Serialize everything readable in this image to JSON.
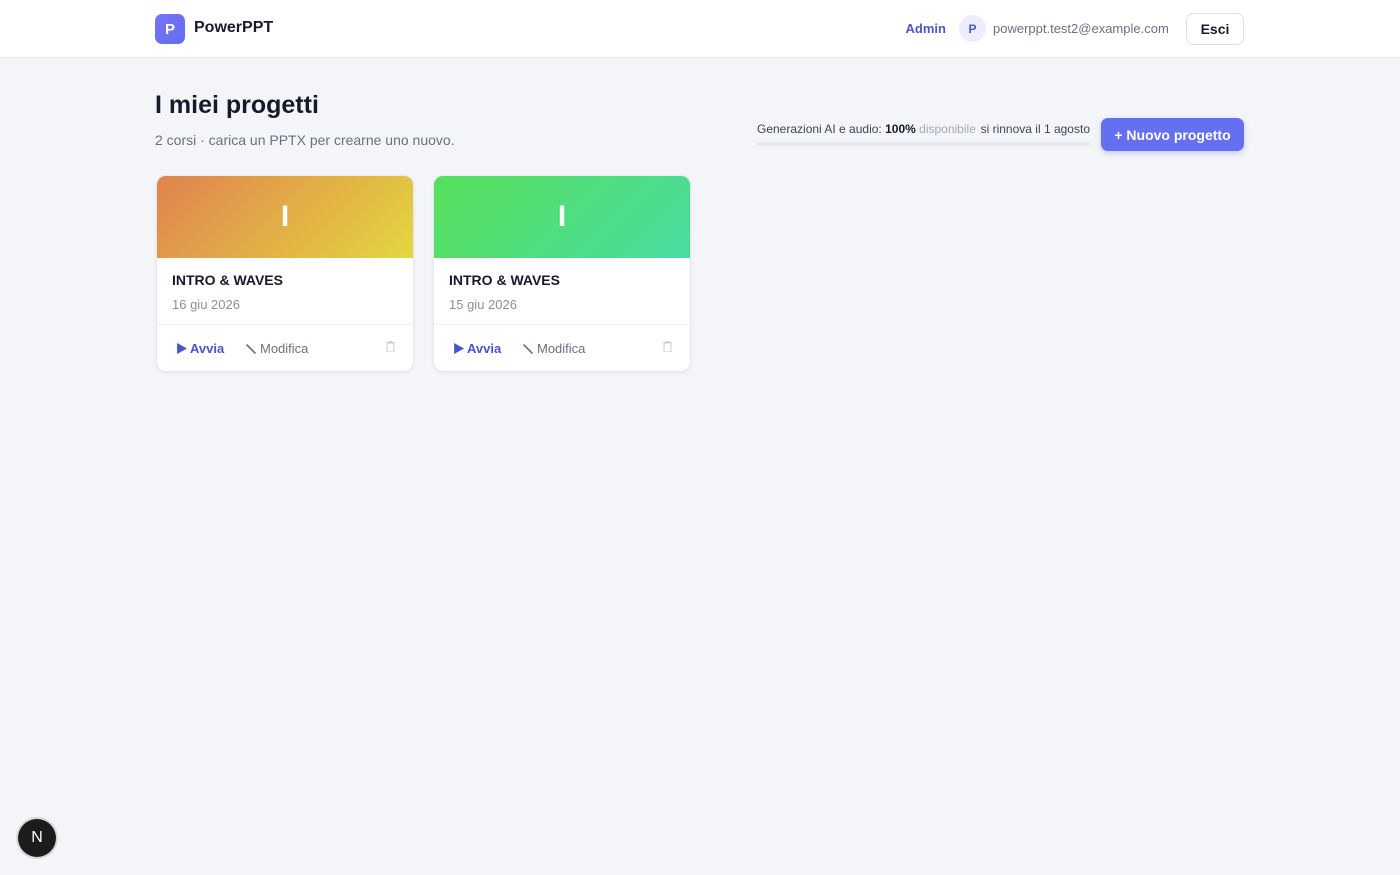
{
  "header": {
    "logo_letter": "P",
    "brand": "PowerPPT",
    "admin_label": "Admin",
    "avatar_letter": "P",
    "email": "powerppt.test2@example.com",
    "logout_label": "Esci"
  },
  "page": {
    "title": "I miei progetti",
    "subtitle": "2 corsi · carica un PPTX per crearne uno nuovo."
  },
  "quota": {
    "label": "Generazioni AI e audio:",
    "percent_text": "100%",
    "available_label": "disponibile",
    "renew_label": "si rinnova il 1 agosto",
    "fill_percent": 100
  },
  "actions": {
    "new_project_label": "+ Nuovo progetto"
  },
  "projects": [
    {
      "cover_letter": "I",
      "title": "INTRO & WAVES",
      "date": "16 giu 2026",
      "start_label": "Avvia",
      "edit_label": "Modifica",
      "cover_from": "#e0834f",
      "cover_to": "#e3d73f"
    },
    {
      "cover_letter": "I",
      "title": "INTRO & WAVES",
      "date": "15 giu 2026",
      "start_label": "Avvia",
      "edit_label": "Modifica",
      "cover_from": "#57e05a",
      "cover_to": "#49dba0"
    }
  ],
  "dev_badge": {
    "letter": "N"
  }
}
